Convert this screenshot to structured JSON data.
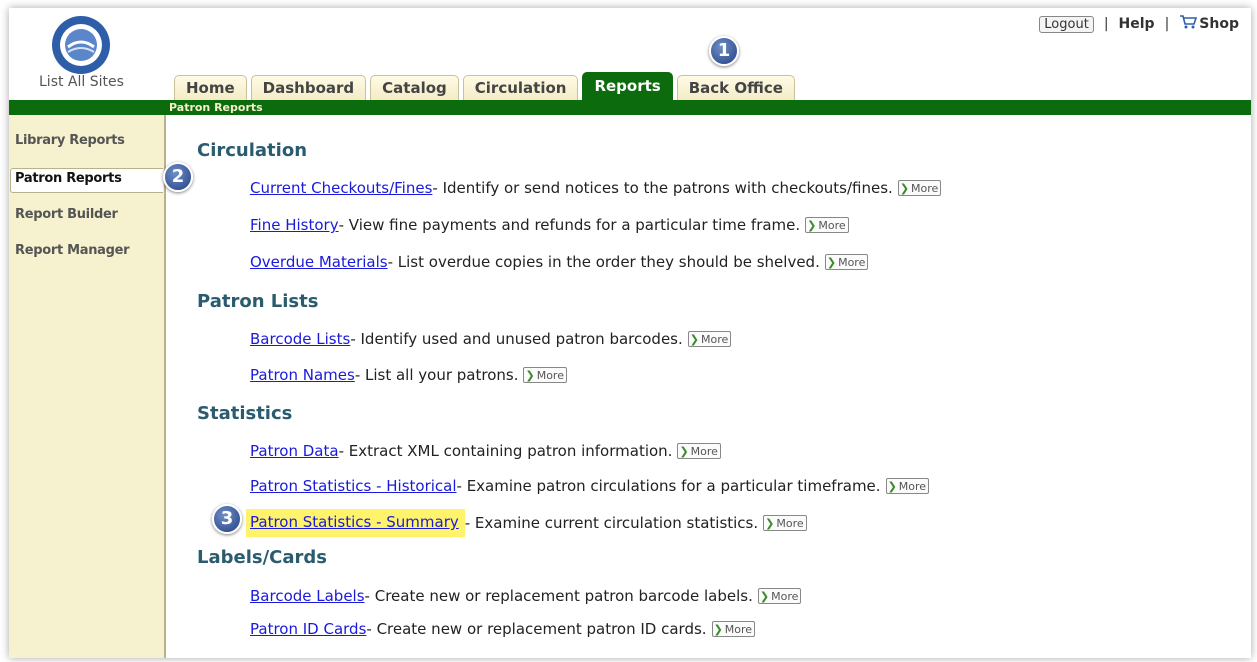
{
  "header": {
    "list_all_sites": "List All Sites",
    "logout": "Logout",
    "separator": "|",
    "help": "Help",
    "shop": "Shop"
  },
  "tabs": [
    {
      "label": "Home"
    },
    {
      "label": "Dashboard"
    },
    {
      "label": "Catalog"
    },
    {
      "label": "Circulation"
    },
    {
      "label": "Reports",
      "active": true
    },
    {
      "label": "Back Office"
    }
  ],
  "subheader": "Patron Reports",
  "sidebar": {
    "items": [
      {
        "label": "Library Reports"
      },
      {
        "label": "Patron Reports",
        "active": true
      },
      {
        "label": "Report Builder"
      },
      {
        "label": "Report Manager"
      }
    ]
  },
  "more_label": "More",
  "sections": [
    {
      "title": "Circulation",
      "rows": [
        {
          "link": "Current Checkouts/Fines",
          "desc": " - Identify or send notices to the patrons with checkouts/fines."
        },
        {
          "link": "Fine History",
          "desc": " - View fine payments and refunds for a particular time frame."
        },
        {
          "link": "Overdue Materials",
          "desc": " - List overdue copies in the order they should be shelved."
        }
      ]
    },
    {
      "title": "Patron Lists",
      "rows": [
        {
          "link": "Barcode Lists",
          "desc": " - Identify used and unused patron barcodes."
        },
        {
          "link": "Patron Names",
          "desc": " - List all your patrons."
        }
      ]
    },
    {
      "title": "Statistics",
      "rows": [
        {
          "link": "Patron Data",
          "desc": " - Extract XML containing patron information."
        },
        {
          "link": "Patron Statistics - Historical",
          "desc": " - Examine patron circulations for a particular timeframe."
        },
        {
          "link": "Patron Statistics - Summary",
          "desc": " - Examine current circulation statistics."
        }
      ]
    },
    {
      "title": "Labels/Cards",
      "rows": [
        {
          "link": "Barcode Labels",
          "desc": " - Create new or replacement patron barcode labels."
        },
        {
          "link": "Patron ID Cards",
          "desc": " - Create new or replacement patron ID cards."
        }
      ]
    }
  ],
  "callouts": [
    "1",
    "2",
    "3"
  ],
  "colors": {
    "nav_green": "#0c6b0c",
    "highlight": "#fff36b",
    "section_title": "#2a5b6e",
    "link": "#1a1adb"
  }
}
